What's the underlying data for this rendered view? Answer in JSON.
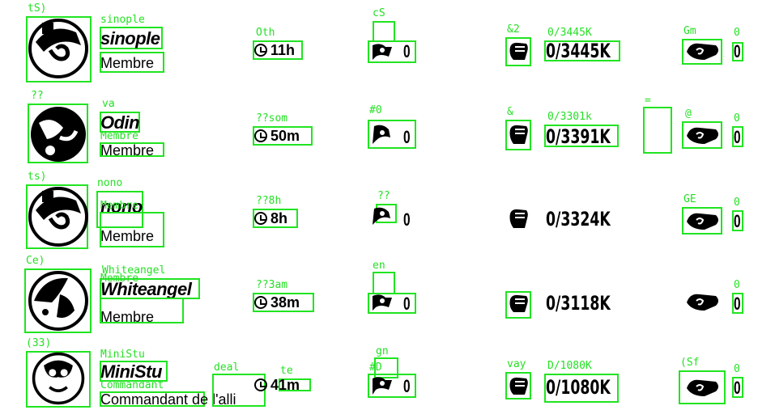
{
  "rows": [
    {
      "avatar_ann": "tS)",
      "name_ann": "sinople",
      "name": "sinople",
      "rank": "Membre",
      "time_ann": "Oth",
      "time": "11h",
      "icon1_ann": "cS",
      "count1": "0",
      "icon2_ann": "&2",
      "score_ann": "0/3445K",
      "score": "0/3445K",
      "icon3_ann": "Gm",
      "count3_ann": "0",
      "count3": "0"
    },
    {
      "avatar_ann": "??",
      "name_ann": "va",
      "name": "Odin",
      "name_sub_ann": "Membre",
      "rank": "Membre",
      "time_ann": "??som",
      "time": "50m",
      "icon1_ann": "#0",
      "count1": "0",
      "icon2_ann": "&",
      "score_ann": "0/3301k",
      "score": "0/3391K",
      "extra_ann": "=",
      "icon3_ann": "@",
      "count3_ann": "0",
      "count3": "0"
    },
    {
      "avatar_ann": "ts)",
      "name_ann": "nono",
      "name": "nono",
      "name_sub_ann": "Membre",
      "rank": "Membre",
      "time_ann": "??8h",
      "time": "8h",
      "icon1_ann": "??",
      "count1": "0",
      "score": "0/3324K",
      "icon3_ann": "GE",
      "count3_ann": "0",
      "count3": "0"
    },
    {
      "avatar_ann": "Ce)",
      "name_ann": "Whiteangel",
      "name": "Whiteangel",
      "name_sub_ann": "Membre",
      "rank": "Membre",
      "time_ann": "??3am",
      "time": "38m",
      "icon1_ann": "en",
      "count1": "0",
      "score": "0/3118K",
      "count3_ann": "0",
      "count3": "0"
    },
    {
      "avatar_ann": "(33)",
      "name_ann": "MiniStu",
      "name": "MiniStu",
      "name_sub_ann": "Commandant",
      "rank": "Commandant de l'alli",
      "deal_ann": "deal",
      "time_ann": "te",
      "time": "41m",
      "icon1_ann": "gn",
      "icon1b_ann": "#D",
      "count1": "0",
      "icon2_ann": "vay",
      "score_ann": "D/1080K",
      "score": "0/1080K",
      "icon3_ann": "(Sf",
      "count3_ann": "0",
      "count3": "0"
    }
  ],
  "colors": {
    "annotation": "#26e026",
    "box": "#21e421",
    "ink": "#000000",
    "background": "#ffffff"
  },
  "icons": [
    "avatar-icon",
    "clock-icon",
    "flag-icon",
    "fist-icon",
    "hand-icon"
  ]
}
